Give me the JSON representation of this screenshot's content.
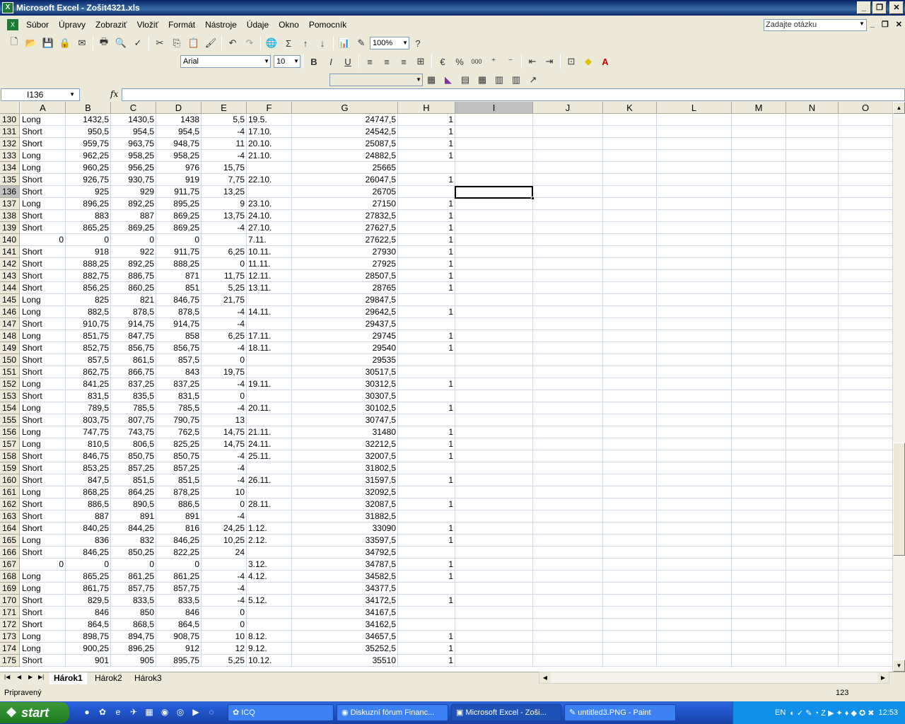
{
  "window": {
    "title": "Microsoft Excel - Zošit4321.xls"
  },
  "menu": [
    "Súbor",
    "Úpravy",
    "Zobraziť",
    "Vložiť",
    "Formát",
    "Nástroje",
    "Údaje",
    "Okno",
    "Pomocník"
  ],
  "ask_placeholder": "Zadajte otázku",
  "toolbar": {
    "zoom": "100%",
    "font": "Arial",
    "size": "10",
    "comma": "000"
  },
  "formula": {
    "namebox": "I136",
    "fx": "fx",
    "content": ""
  },
  "columns": [
    "A",
    "B",
    "C",
    "D",
    "E",
    "F",
    "G",
    "H",
    "I",
    "J",
    "K",
    "L",
    "M",
    "N",
    "O"
  ],
  "selected_column": "I",
  "selected_row": "136",
  "rows": [
    [
      "130",
      "Long",
      "1432,5",
      "1430,5",
      "1438",
      "5,5",
      "19.5.",
      "24747,5",
      "1"
    ],
    [
      "131",
      "Short",
      "950,5",
      "954,5",
      "954,5",
      "-4",
      "17.10.",
      "24542,5",
      "1"
    ],
    [
      "132",
      "Short",
      "959,75",
      "963,75",
      "948,75",
      "11",
      "20.10.",
      "25087,5",
      "1"
    ],
    [
      "133",
      "Long",
      "962,25",
      "958,25",
      "958,25",
      "-4",
      "21.10.",
      "24882,5",
      "1"
    ],
    [
      "134",
      "Long",
      "960,25",
      "956,25",
      "976",
      "15,75",
      "",
      "25665",
      ""
    ],
    [
      "135",
      "Short",
      "926,75",
      "930,75",
      "919",
      "7,75",
      "22.10.",
      "26047,5",
      "1"
    ],
    [
      "136",
      "Short",
      "925",
      "929",
      "911,75",
      "13,25",
      "",
      "26705",
      ""
    ],
    [
      "137",
      "Long",
      "896,25",
      "892,25",
      "895,25",
      "9",
      "23.10.",
      "27150",
      "1"
    ],
    [
      "138",
      "Short",
      "883",
      "887",
      "869,25",
      "13,75",
      "24.10.",
      "27832,5",
      "1"
    ],
    [
      "139",
      "Short",
      "865,25",
      "869,25",
      "869,25",
      "-4",
      "27.10.",
      "27627,5",
      "1"
    ],
    [
      "140",
      "0",
      "0",
      "0",
      "0",
      "",
      "7.11.",
      "27622,5",
      "1"
    ],
    [
      "141",
      "Short",
      "918",
      "922",
      "911,75",
      "6,25",
      "10.11.",
      "27930",
      "1"
    ],
    [
      "142",
      "Short",
      "888,25",
      "892,25",
      "888,25",
      "0",
      "11.11.",
      "27925",
      "1"
    ],
    [
      "143",
      "Short",
      "882,75",
      "886,75",
      "871",
      "11,75",
      "12.11.",
      "28507,5",
      "1"
    ],
    [
      "144",
      "Short",
      "856,25",
      "860,25",
      "851",
      "5,25",
      "13.11.",
      "28765",
      "1"
    ],
    [
      "145",
      "Long",
      "825",
      "821",
      "846,75",
      "21,75",
      "",
      "29847,5",
      ""
    ],
    [
      "146",
      "Long",
      "882,5",
      "878,5",
      "878,5",
      "-4",
      "14.11.",
      "29642,5",
      "1"
    ],
    [
      "147",
      "Short",
      "910,75",
      "914,75",
      "914,75",
      "-4",
      "",
      "29437,5",
      ""
    ],
    [
      "148",
      "Long",
      "851,75",
      "847,75",
      "858",
      "6,25",
      "17.11.",
      "29745",
      "1"
    ],
    [
      "149",
      "Short",
      "852,75",
      "856,75",
      "856,75",
      "-4",
      "18.11.",
      "29540",
      "1"
    ],
    [
      "150",
      "Short",
      "857,5",
      "861,5",
      "857,5",
      "0",
      "",
      "29535",
      ""
    ],
    [
      "151",
      "Short",
      "862,75",
      "866,75",
      "843",
      "19,75",
      "",
      "30517,5",
      ""
    ],
    [
      "152",
      "Long",
      "841,25",
      "837,25",
      "837,25",
      "-4",
      "19.11.",
      "30312,5",
      "1"
    ],
    [
      "153",
      "Short",
      "831,5",
      "835,5",
      "831,5",
      "0",
      "",
      "30307,5",
      ""
    ],
    [
      "154",
      "Long",
      "789,5",
      "785,5",
      "785,5",
      "-4",
      "20.11.",
      "30102,5",
      "1"
    ],
    [
      "155",
      "Short",
      "803,75",
      "807,75",
      "790,75",
      "13",
      "",
      "30747,5",
      ""
    ],
    [
      "156",
      "Long",
      "747,75",
      "743,75",
      "762,5",
      "14,75",
      "21.11.",
      "31480",
      "1"
    ],
    [
      "157",
      "Long",
      "810,5",
      "806,5",
      "825,25",
      "14,75",
      "24.11.",
      "32212,5",
      "1"
    ],
    [
      "158",
      "Short",
      "846,75",
      "850,75",
      "850,75",
      "-4",
      "25.11.",
      "32007,5",
      "1"
    ],
    [
      "159",
      "Short",
      "853,25",
      "857,25",
      "857,25",
      "-4",
      "",
      "31802,5",
      ""
    ],
    [
      "160",
      "Short",
      "847,5",
      "851,5",
      "851,5",
      "-4",
      "26.11.",
      "31597,5",
      "1"
    ],
    [
      "161",
      "Long",
      "868,25",
      "864,25",
      "878,25",
      "10",
      "",
      "32092,5",
      ""
    ],
    [
      "162",
      "Short",
      "886,5",
      "890,5",
      "886,5",
      "0",
      "28.11.",
      "32087,5",
      "1"
    ],
    [
      "163",
      "Short",
      "887",
      "891",
      "891",
      "-4",
      "",
      "31882,5",
      ""
    ],
    [
      "164",
      "Short",
      "840,25",
      "844,25",
      "816",
      "24,25",
      "1.12.",
      "33090",
      "1"
    ],
    [
      "165",
      "Long",
      "836",
      "832",
      "846,25",
      "10,25",
      "2.12.",
      "33597,5",
      "1"
    ],
    [
      "166",
      "Short",
      "846,25",
      "850,25",
      "822,25",
      "24",
      "",
      "34792,5",
      ""
    ],
    [
      "167",
      "0",
      "0",
      "0",
      "0",
      "",
      "3.12.",
      "34787,5",
      "1"
    ],
    [
      "168",
      "Long",
      "865,25",
      "861,25",
      "861,25",
      "-4",
      "4.12.",
      "34582,5",
      "1"
    ],
    [
      "169",
      "Long",
      "861,75",
      "857,75",
      "857,75",
      "-4",
      "",
      "34377,5",
      ""
    ],
    [
      "170",
      "Short",
      "829,5",
      "833,5",
      "833,5",
      "-4",
      "5.12.",
      "34172,5",
      "1"
    ],
    [
      "171",
      "Short",
      "846",
      "850",
      "846",
      "0",
      "",
      "34167,5",
      ""
    ],
    [
      "172",
      "Short",
      "864,5",
      "868,5",
      "864,5",
      "0",
      "",
      "34162,5",
      ""
    ],
    [
      "173",
      "Long",
      "898,75",
      "894,75",
      "908,75",
      "10",
      "8.12.",
      "34657,5",
      "1"
    ],
    [
      "174",
      "Long",
      "900,25",
      "896,25",
      "912",
      "12",
      "9.12.",
      "35252,5",
      "1"
    ],
    [
      "175",
      "Short",
      "901",
      "905",
      "895,75",
      "5,25",
      "10.12.",
      "35510",
      "1"
    ]
  ],
  "sheets": [
    "Hárok1",
    "Hárok2",
    "Hárok3"
  ],
  "status": {
    "left": "Pripravený",
    "right": "123"
  },
  "taskbar": {
    "start": "start",
    "tasks": [
      "ICQ",
      "Diskuzní fórum Financ...",
      "Microsoft Excel - Zoši...",
      "untitled3.PNG - Paint"
    ],
    "lang": "EN",
    "clock": "12:53"
  }
}
